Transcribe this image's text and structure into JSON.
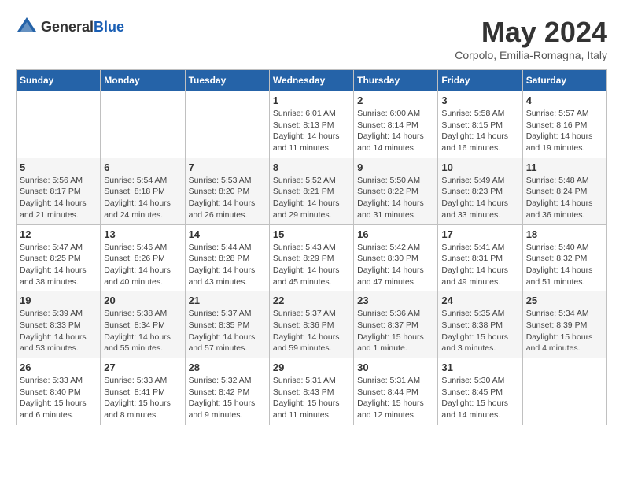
{
  "header": {
    "logo_general": "General",
    "logo_blue": "Blue",
    "title": "May 2024",
    "subtitle": "Corpolo, Emilia-Romagna, Italy"
  },
  "weekdays": [
    "Sunday",
    "Monday",
    "Tuesday",
    "Wednesday",
    "Thursday",
    "Friday",
    "Saturday"
  ],
  "weeks": [
    [
      {
        "day": "",
        "detail": ""
      },
      {
        "day": "",
        "detail": ""
      },
      {
        "day": "",
        "detail": ""
      },
      {
        "day": "1",
        "detail": "Sunrise: 6:01 AM\nSunset: 8:13 PM\nDaylight: 14 hours\nand 11 minutes."
      },
      {
        "day": "2",
        "detail": "Sunrise: 6:00 AM\nSunset: 8:14 PM\nDaylight: 14 hours\nand 14 minutes."
      },
      {
        "day": "3",
        "detail": "Sunrise: 5:58 AM\nSunset: 8:15 PM\nDaylight: 14 hours\nand 16 minutes."
      },
      {
        "day": "4",
        "detail": "Sunrise: 5:57 AM\nSunset: 8:16 PM\nDaylight: 14 hours\nand 19 minutes."
      }
    ],
    [
      {
        "day": "5",
        "detail": "Sunrise: 5:56 AM\nSunset: 8:17 PM\nDaylight: 14 hours\nand 21 minutes."
      },
      {
        "day": "6",
        "detail": "Sunrise: 5:54 AM\nSunset: 8:18 PM\nDaylight: 14 hours\nand 24 minutes."
      },
      {
        "day": "7",
        "detail": "Sunrise: 5:53 AM\nSunset: 8:20 PM\nDaylight: 14 hours\nand 26 minutes."
      },
      {
        "day": "8",
        "detail": "Sunrise: 5:52 AM\nSunset: 8:21 PM\nDaylight: 14 hours\nand 29 minutes."
      },
      {
        "day": "9",
        "detail": "Sunrise: 5:50 AM\nSunset: 8:22 PM\nDaylight: 14 hours\nand 31 minutes."
      },
      {
        "day": "10",
        "detail": "Sunrise: 5:49 AM\nSunset: 8:23 PM\nDaylight: 14 hours\nand 33 minutes."
      },
      {
        "day": "11",
        "detail": "Sunrise: 5:48 AM\nSunset: 8:24 PM\nDaylight: 14 hours\nand 36 minutes."
      }
    ],
    [
      {
        "day": "12",
        "detail": "Sunrise: 5:47 AM\nSunset: 8:25 PM\nDaylight: 14 hours\nand 38 minutes."
      },
      {
        "day": "13",
        "detail": "Sunrise: 5:46 AM\nSunset: 8:26 PM\nDaylight: 14 hours\nand 40 minutes."
      },
      {
        "day": "14",
        "detail": "Sunrise: 5:44 AM\nSunset: 8:28 PM\nDaylight: 14 hours\nand 43 minutes."
      },
      {
        "day": "15",
        "detail": "Sunrise: 5:43 AM\nSunset: 8:29 PM\nDaylight: 14 hours\nand 45 minutes."
      },
      {
        "day": "16",
        "detail": "Sunrise: 5:42 AM\nSunset: 8:30 PM\nDaylight: 14 hours\nand 47 minutes."
      },
      {
        "day": "17",
        "detail": "Sunrise: 5:41 AM\nSunset: 8:31 PM\nDaylight: 14 hours\nand 49 minutes."
      },
      {
        "day": "18",
        "detail": "Sunrise: 5:40 AM\nSunset: 8:32 PM\nDaylight: 14 hours\nand 51 minutes."
      }
    ],
    [
      {
        "day": "19",
        "detail": "Sunrise: 5:39 AM\nSunset: 8:33 PM\nDaylight: 14 hours\nand 53 minutes."
      },
      {
        "day": "20",
        "detail": "Sunrise: 5:38 AM\nSunset: 8:34 PM\nDaylight: 14 hours\nand 55 minutes."
      },
      {
        "day": "21",
        "detail": "Sunrise: 5:37 AM\nSunset: 8:35 PM\nDaylight: 14 hours\nand 57 minutes."
      },
      {
        "day": "22",
        "detail": "Sunrise: 5:37 AM\nSunset: 8:36 PM\nDaylight: 14 hours\nand 59 minutes."
      },
      {
        "day": "23",
        "detail": "Sunrise: 5:36 AM\nSunset: 8:37 PM\nDaylight: 15 hours\nand 1 minute."
      },
      {
        "day": "24",
        "detail": "Sunrise: 5:35 AM\nSunset: 8:38 PM\nDaylight: 15 hours\nand 3 minutes."
      },
      {
        "day": "25",
        "detail": "Sunrise: 5:34 AM\nSunset: 8:39 PM\nDaylight: 15 hours\nand 4 minutes."
      }
    ],
    [
      {
        "day": "26",
        "detail": "Sunrise: 5:33 AM\nSunset: 8:40 PM\nDaylight: 15 hours\nand 6 minutes."
      },
      {
        "day": "27",
        "detail": "Sunrise: 5:33 AM\nSunset: 8:41 PM\nDaylight: 15 hours\nand 8 minutes."
      },
      {
        "day": "28",
        "detail": "Sunrise: 5:32 AM\nSunset: 8:42 PM\nDaylight: 15 hours\nand 9 minutes."
      },
      {
        "day": "29",
        "detail": "Sunrise: 5:31 AM\nSunset: 8:43 PM\nDaylight: 15 hours\nand 11 minutes."
      },
      {
        "day": "30",
        "detail": "Sunrise: 5:31 AM\nSunset: 8:44 PM\nDaylight: 15 hours\nand 12 minutes."
      },
      {
        "day": "31",
        "detail": "Sunrise: 5:30 AM\nSunset: 8:45 PM\nDaylight: 15 hours\nand 14 minutes."
      },
      {
        "day": "",
        "detail": ""
      }
    ]
  ]
}
